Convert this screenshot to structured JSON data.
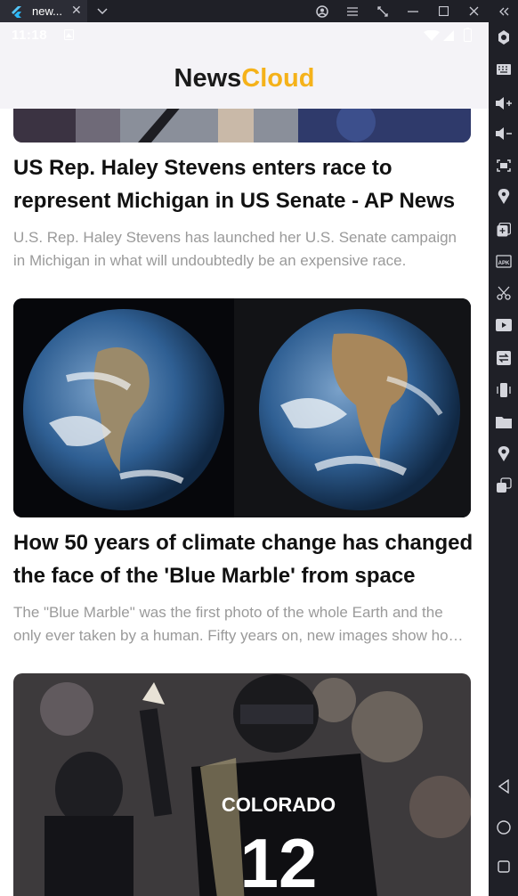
{
  "window": {
    "tab_title": "new...",
    "close_symbol": "✕",
    "dropdown_symbol": "⌄"
  },
  "status_bar": {
    "time": "11:18"
  },
  "app": {
    "title_part1": "News",
    "title_part2": "Cloud",
    "accent_color": "#f5b21a"
  },
  "articles": [
    {
      "title": "US Rep. Haley Stevens enters race to represent Michigan in US Senate - AP News",
      "description": "U.S. Rep. Haley Stevens has launched her U.S. Senate campaign in Michigan in what will undoubtedly be an expensive race."
    },
    {
      "title": "How 50 years of climate change has changed the face of the 'Blue Marble' from space",
      "description": "The \"Blue Marble\" was the first photo of the whole Earth and the only ever taken by a human. Fifty years on, new images show how it has changed."
    },
    {
      "title": "",
      "description": "",
      "jersey_text": "COLORADO",
      "jersey_number": "12"
    }
  ],
  "sidebar_icons": [
    "settings-icon",
    "keyboard-icon",
    "volume-up-icon",
    "volume-down-icon",
    "screenshot-icon",
    "location-pin-icon",
    "add-window-icon",
    "apk-icon",
    "scissors-icon",
    "video-icon",
    "sync-icon",
    "shake-icon",
    "folder-icon",
    "map-pin-icon",
    "multi-window-icon",
    "back-icon",
    "home-icon",
    "recents-icon"
  ]
}
